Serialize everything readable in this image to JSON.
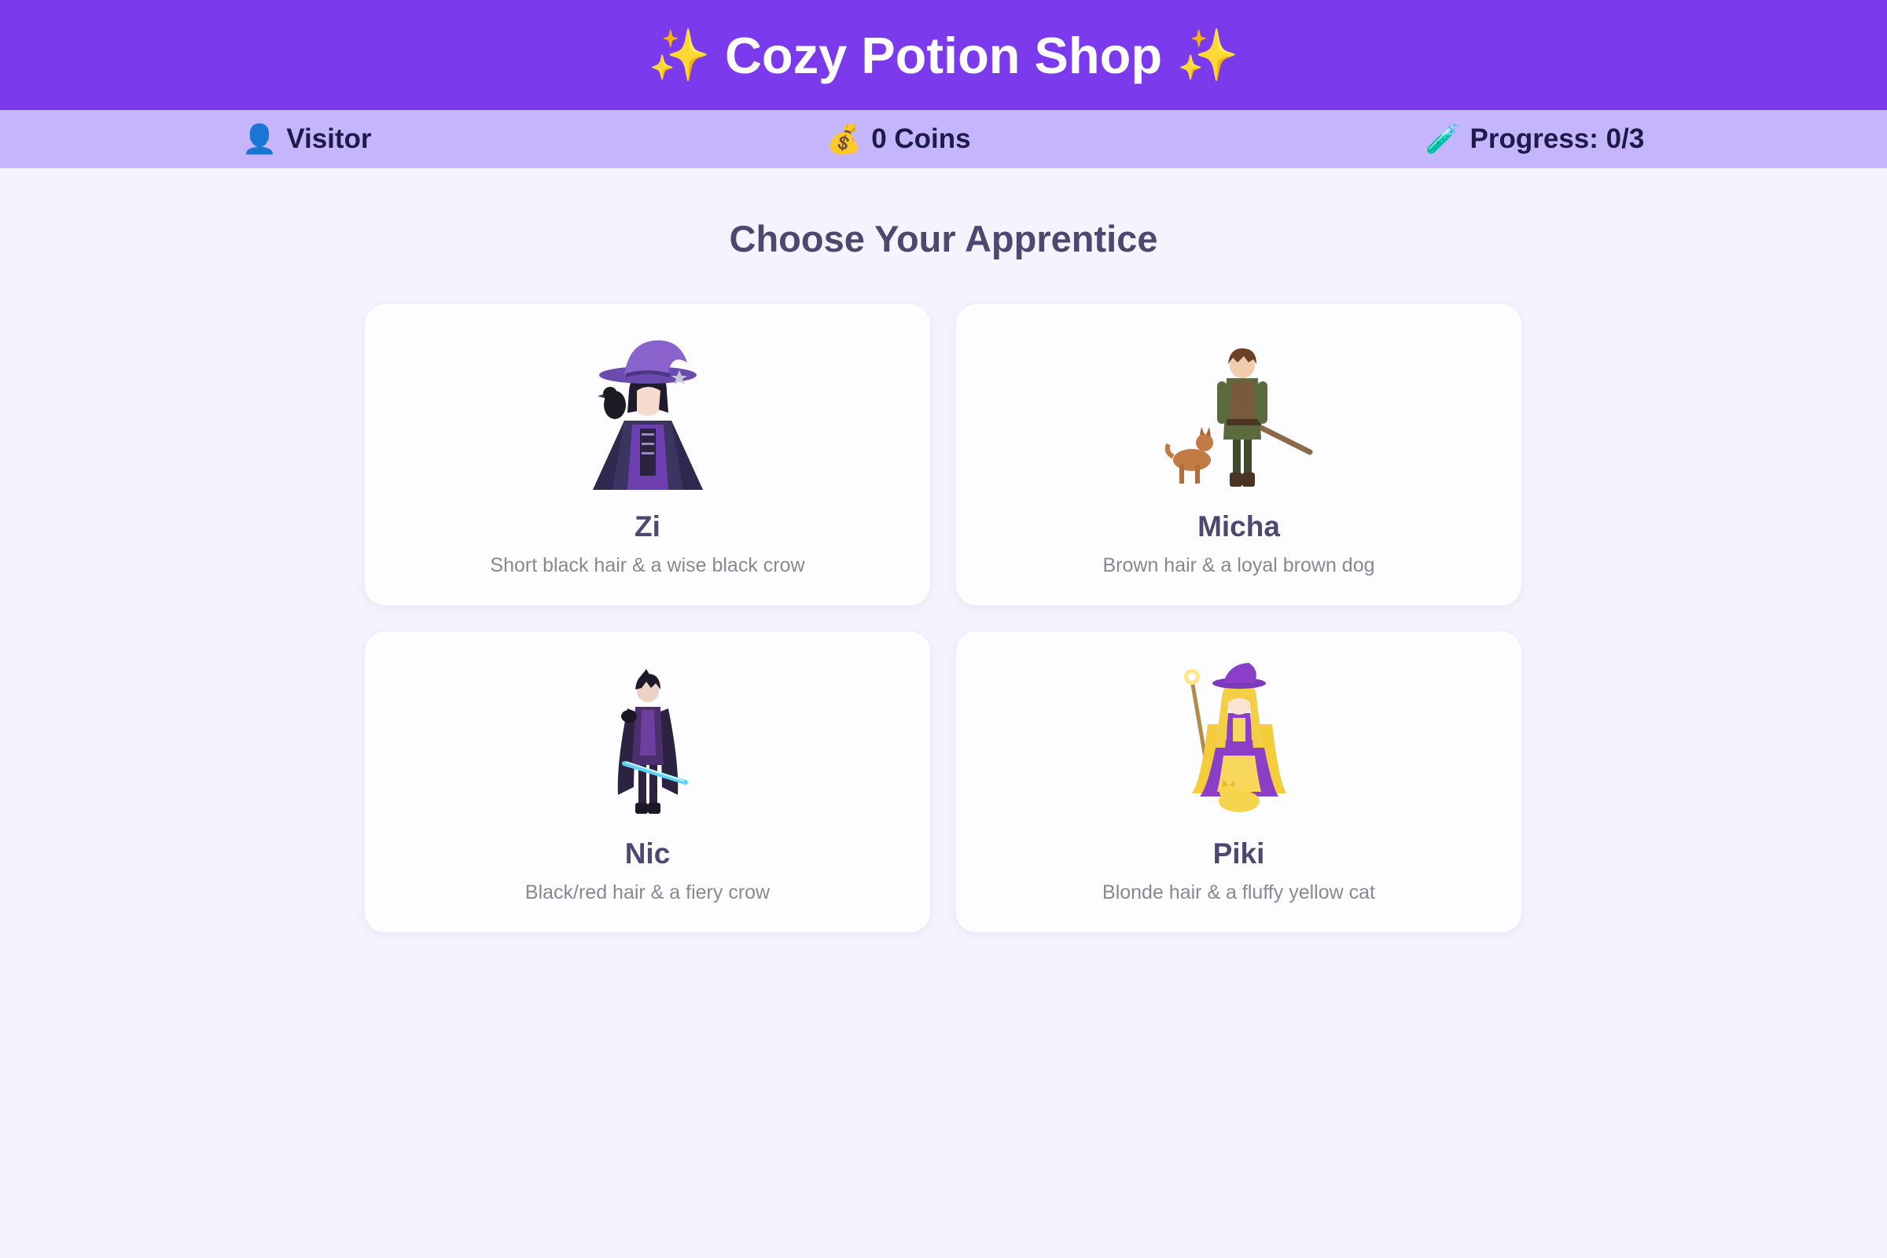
{
  "header": {
    "title": "Cozy Potion Shop",
    "sparkle_icon": "sparkles-icon",
    "background": "#7c3aed"
  },
  "status": {
    "visitor": {
      "icon": "person-icon",
      "label": "Visitor"
    },
    "coins": {
      "icon": "money-bag-icon",
      "label": "0 Coins"
    },
    "progress": {
      "icon": "test-tube-icon",
      "label": "Progress: 0/3"
    }
  },
  "main": {
    "title": "Choose Your Apprentice",
    "apprentices": [
      {
        "name": "Zi",
        "description": "Short black hair & a wise black crow"
      },
      {
        "name": "Micha",
        "description": "Brown hair & a loyal brown dog"
      },
      {
        "name": "Nic",
        "description": "Black/red hair & a fiery crow"
      },
      {
        "name": "Piki",
        "description": "Blonde hair & a fluffy yellow cat"
      }
    ]
  }
}
